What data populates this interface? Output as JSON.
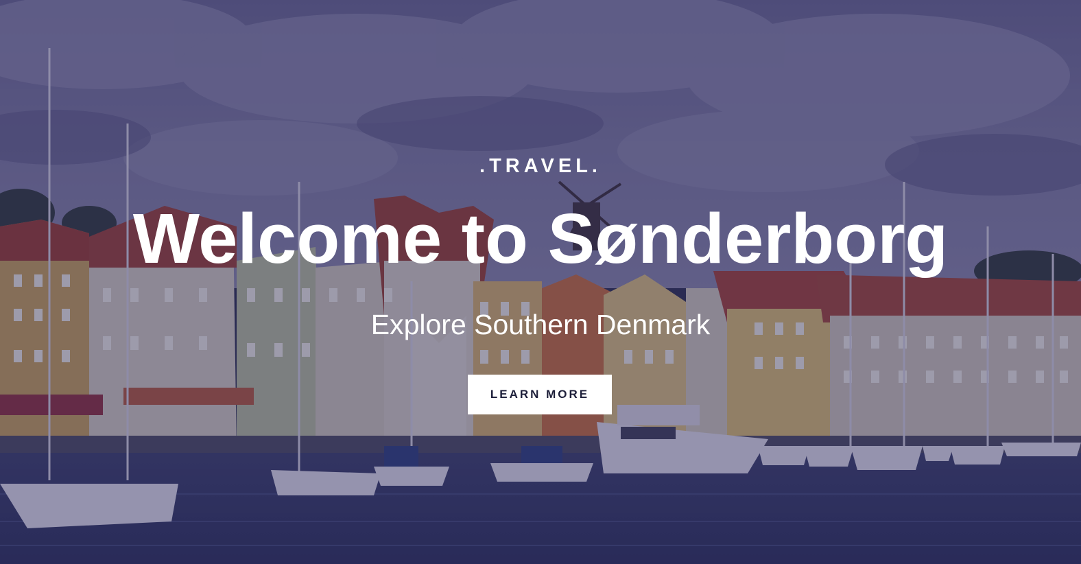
{
  "hero": {
    "eyebrow": ".TRAVEL.",
    "title": "Welcome to Sønderborg",
    "subtitle": "Explore Southern Denmark",
    "cta_label": "LEARN MORE"
  },
  "colors": {
    "overlay": "#28265a",
    "text": "#ffffff",
    "button_bg": "#ffffff",
    "button_text": "#1d1f3a",
    "sky": "#6b6a8e",
    "water": "#3b4470",
    "roof": "#9a3b2e",
    "facade_yellow": "#c9a357",
    "facade_cream": "#d9d2c0",
    "facade_green": "#b8bf9a"
  }
}
